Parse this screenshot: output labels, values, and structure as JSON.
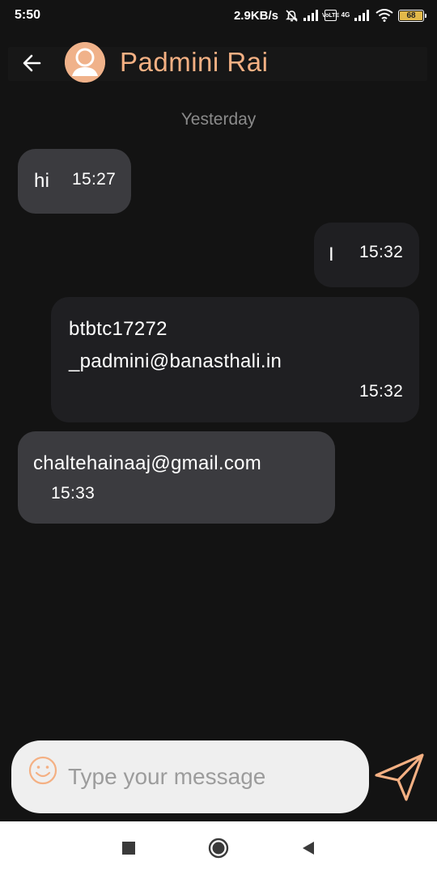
{
  "status_bar": {
    "time": "5:50",
    "net_speed": "2.9KB/s",
    "volte_label": "Vo\nLTE",
    "network_label": "4G",
    "battery_level": "68",
    "battery_color": "#e2b94a"
  },
  "header": {
    "contact_name": "Padmini Rai",
    "accent_color": "#f4b083",
    "back_icon": "arrow-left-icon",
    "avatar_icon": "person-avatar-icon"
  },
  "chat": {
    "date_separator": "Yesterday",
    "messages": [
      {
        "direction": "incoming",
        "text": "hi",
        "time": "15:27"
      },
      {
        "direction": "outgoing",
        "text": "I",
        "time": "15:32"
      },
      {
        "direction": "outgoing",
        "text": "btbtc17272\n_padmini@banasthali.in",
        "time": "15:32"
      },
      {
        "direction": "incoming",
        "text": "chaltehainaaj@gmail.com",
        "time": "15:33"
      }
    ]
  },
  "composer": {
    "placeholder": "Type your message",
    "value": "",
    "emoji_icon": "smiley-icon",
    "send_icon": "send-icon"
  },
  "nav_bar": {
    "recents_icon": "square-icon",
    "home_icon": "circle-icon",
    "back_icon": "triangle-back-icon"
  }
}
